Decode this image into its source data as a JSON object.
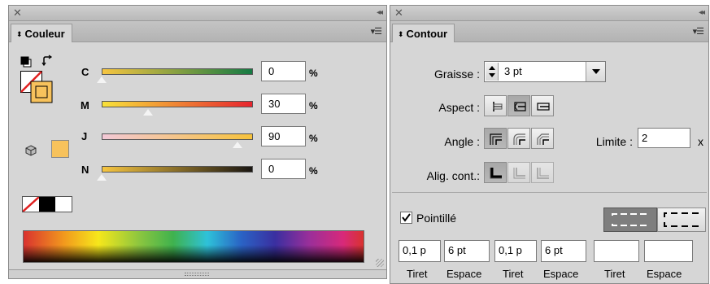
{
  "colour_panel": {
    "tab_label": "Couleur",
    "sliders": [
      {
        "label": "C",
        "value": "0",
        "unit": "%",
        "level": 0.0
      },
      {
        "label": "M",
        "value": "30",
        "unit": "%",
        "level": 0.3
      },
      {
        "label": "J",
        "value": "90",
        "unit": "%",
        "level": 0.9
      },
      {
        "label": "N",
        "value": "0",
        "unit": "%",
        "level": 0.0
      }
    ],
    "fill_color": "#f7c25c",
    "icons": [
      "default-colors-icon",
      "swap-colors-icon",
      "out-of-gamut-cube-icon",
      "none-swatch-icon"
    ]
  },
  "stroke_panel": {
    "tab_label": "Contour",
    "weight_label": "Graisse :",
    "weight_value": "3 pt",
    "cap_label": "Aspect :",
    "corner_label": "Angle :",
    "limit_label": "Limite :",
    "limit_value": "2",
    "limit_unit": "x",
    "align_label": "Alig. cont.:",
    "dashed_label": "Pointillé",
    "dashed_checked": true,
    "dash_fields": [
      {
        "value": "0,1 p",
        "label": "Tiret"
      },
      {
        "value": "6 pt",
        "label": "Espace"
      },
      {
        "value": "0,1 p",
        "label": "Tiret"
      },
      {
        "value": "6 pt",
        "label": "Espace"
      },
      {
        "value": "",
        "label": "Tiret"
      },
      {
        "value": "",
        "label": "Espace"
      }
    ]
  }
}
